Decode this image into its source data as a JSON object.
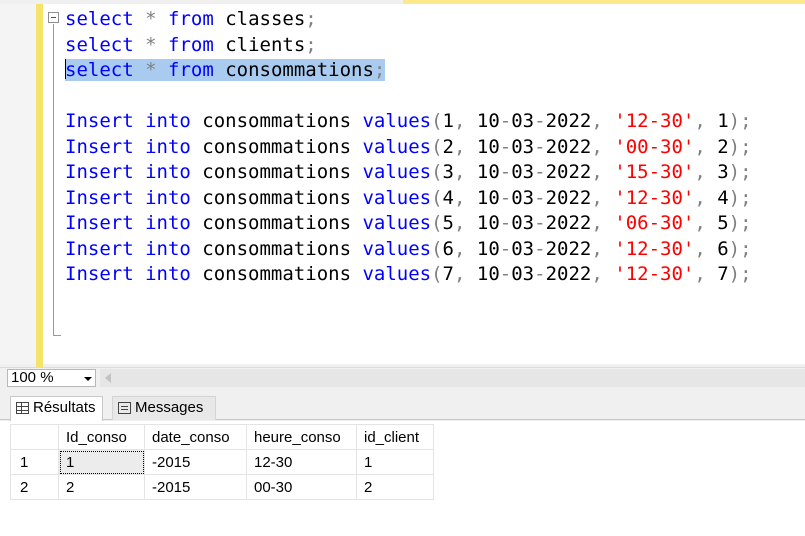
{
  "editor": {
    "lines": [
      {
        "selected": false,
        "caret": false,
        "tokens": [
          {
            "t": "select",
            "c": "kw"
          },
          {
            "t": " ",
            "c": "txt"
          },
          {
            "t": "*",
            "c": "op"
          },
          {
            "t": " ",
            "c": "txt"
          },
          {
            "t": "from",
            "c": "kw"
          },
          {
            "t": " classes",
            "c": "txt"
          },
          {
            "t": ";",
            "c": "op"
          }
        ]
      },
      {
        "selected": false,
        "caret": false,
        "tokens": [
          {
            "t": "select",
            "c": "kw"
          },
          {
            "t": " ",
            "c": "txt"
          },
          {
            "t": "*",
            "c": "op"
          },
          {
            "t": " ",
            "c": "txt"
          },
          {
            "t": "from",
            "c": "kw"
          },
          {
            "t": " clients",
            "c": "txt"
          },
          {
            "t": ";",
            "c": "op"
          }
        ]
      },
      {
        "selected": true,
        "caret": true,
        "tokens": [
          {
            "t": "select",
            "c": "kw"
          },
          {
            "t": " ",
            "c": "txt"
          },
          {
            "t": "*",
            "c": "op"
          },
          {
            "t": " ",
            "c": "txt"
          },
          {
            "t": "from",
            "c": "kw"
          },
          {
            "t": " consommations",
            "c": "txt"
          },
          {
            "t": ";",
            "c": "op"
          }
        ]
      },
      {
        "selected": false,
        "caret": false,
        "tokens": []
      },
      {
        "selected": false,
        "caret": false,
        "tokens": [
          {
            "t": "Insert",
            "c": "kw"
          },
          {
            "t": " ",
            "c": "txt"
          },
          {
            "t": "into",
            "c": "kw"
          },
          {
            "t": " consommations ",
            "c": "txt"
          },
          {
            "t": "values",
            "c": "kw"
          },
          {
            "t": "(",
            "c": "op"
          },
          {
            "t": "1",
            "c": "txt"
          },
          {
            "t": ",",
            "c": "op"
          },
          {
            "t": " 10",
            "c": "txt"
          },
          {
            "t": "-",
            "c": "op"
          },
          {
            "t": "03",
            "c": "txt"
          },
          {
            "t": "-",
            "c": "op"
          },
          {
            "t": "2022",
            "c": "txt"
          },
          {
            "t": ",",
            "c": "op"
          },
          {
            "t": " ",
            "c": "txt"
          },
          {
            "t": "'12-30'",
            "c": "str"
          },
          {
            "t": ",",
            "c": "op"
          },
          {
            "t": " 1",
            "c": "txt"
          },
          {
            "t": ");",
            "c": "op"
          }
        ]
      },
      {
        "selected": false,
        "caret": false,
        "tokens": [
          {
            "t": "Insert",
            "c": "kw"
          },
          {
            "t": " ",
            "c": "txt"
          },
          {
            "t": "into",
            "c": "kw"
          },
          {
            "t": " consommations ",
            "c": "txt"
          },
          {
            "t": "values",
            "c": "kw"
          },
          {
            "t": "(",
            "c": "op"
          },
          {
            "t": "2",
            "c": "txt"
          },
          {
            "t": ",",
            "c": "op"
          },
          {
            "t": " 10",
            "c": "txt"
          },
          {
            "t": "-",
            "c": "op"
          },
          {
            "t": "03",
            "c": "txt"
          },
          {
            "t": "-",
            "c": "op"
          },
          {
            "t": "2022",
            "c": "txt"
          },
          {
            "t": ",",
            "c": "op"
          },
          {
            "t": " ",
            "c": "txt"
          },
          {
            "t": "'00-30'",
            "c": "str"
          },
          {
            "t": ",",
            "c": "op"
          },
          {
            "t": " 2",
            "c": "txt"
          },
          {
            "t": ");",
            "c": "op"
          }
        ]
      },
      {
        "selected": false,
        "caret": false,
        "tokens": [
          {
            "t": "Insert",
            "c": "kw"
          },
          {
            "t": " ",
            "c": "txt"
          },
          {
            "t": "into",
            "c": "kw"
          },
          {
            "t": " consommations ",
            "c": "txt"
          },
          {
            "t": "values",
            "c": "kw"
          },
          {
            "t": "(",
            "c": "op"
          },
          {
            "t": "3",
            "c": "txt"
          },
          {
            "t": ",",
            "c": "op"
          },
          {
            "t": " 10",
            "c": "txt"
          },
          {
            "t": "-",
            "c": "op"
          },
          {
            "t": "03",
            "c": "txt"
          },
          {
            "t": "-",
            "c": "op"
          },
          {
            "t": "2022",
            "c": "txt"
          },
          {
            "t": ",",
            "c": "op"
          },
          {
            "t": " ",
            "c": "txt"
          },
          {
            "t": "'15-30'",
            "c": "str"
          },
          {
            "t": ",",
            "c": "op"
          },
          {
            "t": " 3",
            "c": "txt"
          },
          {
            "t": ");",
            "c": "op"
          }
        ]
      },
      {
        "selected": false,
        "caret": false,
        "tokens": [
          {
            "t": "Insert",
            "c": "kw"
          },
          {
            "t": " ",
            "c": "txt"
          },
          {
            "t": "into",
            "c": "kw"
          },
          {
            "t": " consommations ",
            "c": "txt"
          },
          {
            "t": "values",
            "c": "kw"
          },
          {
            "t": "(",
            "c": "op"
          },
          {
            "t": "4",
            "c": "txt"
          },
          {
            "t": ",",
            "c": "op"
          },
          {
            "t": " 10",
            "c": "txt"
          },
          {
            "t": "-",
            "c": "op"
          },
          {
            "t": "03",
            "c": "txt"
          },
          {
            "t": "-",
            "c": "op"
          },
          {
            "t": "2022",
            "c": "txt"
          },
          {
            "t": ",",
            "c": "op"
          },
          {
            "t": " ",
            "c": "txt"
          },
          {
            "t": "'12-30'",
            "c": "str"
          },
          {
            "t": ",",
            "c": "op"
          },
          {
            "t": " 4",
            "c": "txt"
          },
          {
            "t": ");",
            "c": "op"
          }
        ]
      },
      {
        "selected": false,
        "caret": false,
        "tokens": [
          {
            "t": "Insert",
            "c": "kw"
          },
          {
            "t": " ",
            "c": "txt"
          },
          {
            "t": "into",
            "c": "kw"
          },
          {
            "t": " consommations ",
            "c": "txt"
          },
          {
            "t": "values",
            "c": "kw"
          },
          {
            "t": "(",
            "c": "op"
          },
          {
            "t": "5",
            "c": "txt"
          },
          {
            "t": ",",
            "c": "op"
          },
          {
            "t": " 10",
            "c": "txt"
          },
          {
            "t": "-",
            "c": "op"
          },
          {
            "t": "03",
            "c": "txt"
          },
          {
            "t": "-",
            "c": "op"
          },
          {
            "t": "2022",
            "c": "txt"
          },
          {
            "t": ",",
            "c": "op"
          },
          {
            "t": " ",
            "c": "txt"
          },
          {
            "t": "'06-30'",
            "c": "str"
          },
          {
            "t": ",",
            "c": "op"
          },
          {
            "t": " 5",
            "c": "txt"
          },
          {
            "t": ");",
            "c": "op"
          }
        ]
      },
      {
        "selected": false,
        "caret": false,
        "tokens": [
          {
            "t": "Insert",
            "c": "kw"
          },
          {
            "t": " ",
            "c": "txt"
          },
          {
            "t": "into",
            "c": "kw"
          },
          {
            "t": " consommations ",
            "c": "txt"
          },
          {
            "t": "values",
            "c": "kw"
          },
          {
            "t": "(",
            "c": "op"
          },
          {
            "t": "6",
            "c": "txt"
          },
          {
            "t": ",",
            "c": "op"
          },
          {
            "t": " 10",
            "c": "txt"
          },
          {
            "t": "-",
            "c": "op"
          },
          {
            "t": "03",
            "c": "txt"
          },
          {
            "t": "-",
            "c": "op"
          },
          {
            "t": "2022",
            "c": "txt"
          },
          {
            "t": ",",
            "c": "op"
          },
          {
            "t": " ",
            "c": "txt"
          },
          {
            "t": "'12-30'",
            "c": "str"
          },
          {
            "t": ",",
            "c": "op"
          },
          {
            "t": " 6",
            "c": "txt"
          },
          {
            "t": ");",
            "c": "op"
          }
        ]
      },
      {
        "selected": false,
        "caret": false,
        "tokens": [
          {
            "t": "Insert",
            "c": "kw"
          },
          {
            "t": " ",
            "c": "txt"
          },
          {
            "t": "into",
            "c": "kw"
          },
          {
            "t": " consommations ",
            "c": "txt"
          },
          {
            "t": "values",
            "c": "kw"
          },
          {
            "t": "(",
            "c": "op"
          },
          {
            "t": "7",
            "c": "txt"
          },
          {
            "t": ",",
            "c": "op"
          },
          {
            "t": " 10",
            "c": "txt"
          },
          {
            "t": "-",
            "c": "op"
          },
          {
            "t": "03",
            "c": "txt"
          },
          {
            "t": "-",
            "c": "op"
          },
          {
            "t": "2022",
            "c": "txt"
          },
          {
            "t": ",",
            "c": "op"
          },
          {
            "t": " ",
            "c": "txt"
          },
          {
            "t": "'12-30'",
            "c": "str"
          },
          {
            "t": ",",
            "c": "op"
          },
          {
            "t": " 7",
            "c": "txt"
          },
          {
            "t": ");",
            "c": "op"
          }
        ]
      }
    ]
  },
  "zoom": {
    "value": "100 %"
  },
  "tabs": {
    "results_label": "Résultats",
    "messages_label": "Messages",
    "results_icon": "grid-icon",
    "messages_icon": "messages-icon"
  },
  "results_grid": {
    "columns": [
      "Id_conso",
      "date_conso",
      "heure_conso",
      "id_client"
    ],
    "rows": [
      {
        "num": "1",
        "cells": [
          "1",
          "-2015",
          "12-30",
          "1"
        ]
      },
      {
        "num": "2",
        "cells": [
          "2",
          "-2015",
          "00-30",
          "2"
        ]
      }
    ]
  },
  "colors": {
    "keyword": "#0000ff",
    "operator": "#808080",
    "string": "#ff0000",
    "selection": "#aacbf0",
    "change_bar": "#f5e36a"
  }
}
